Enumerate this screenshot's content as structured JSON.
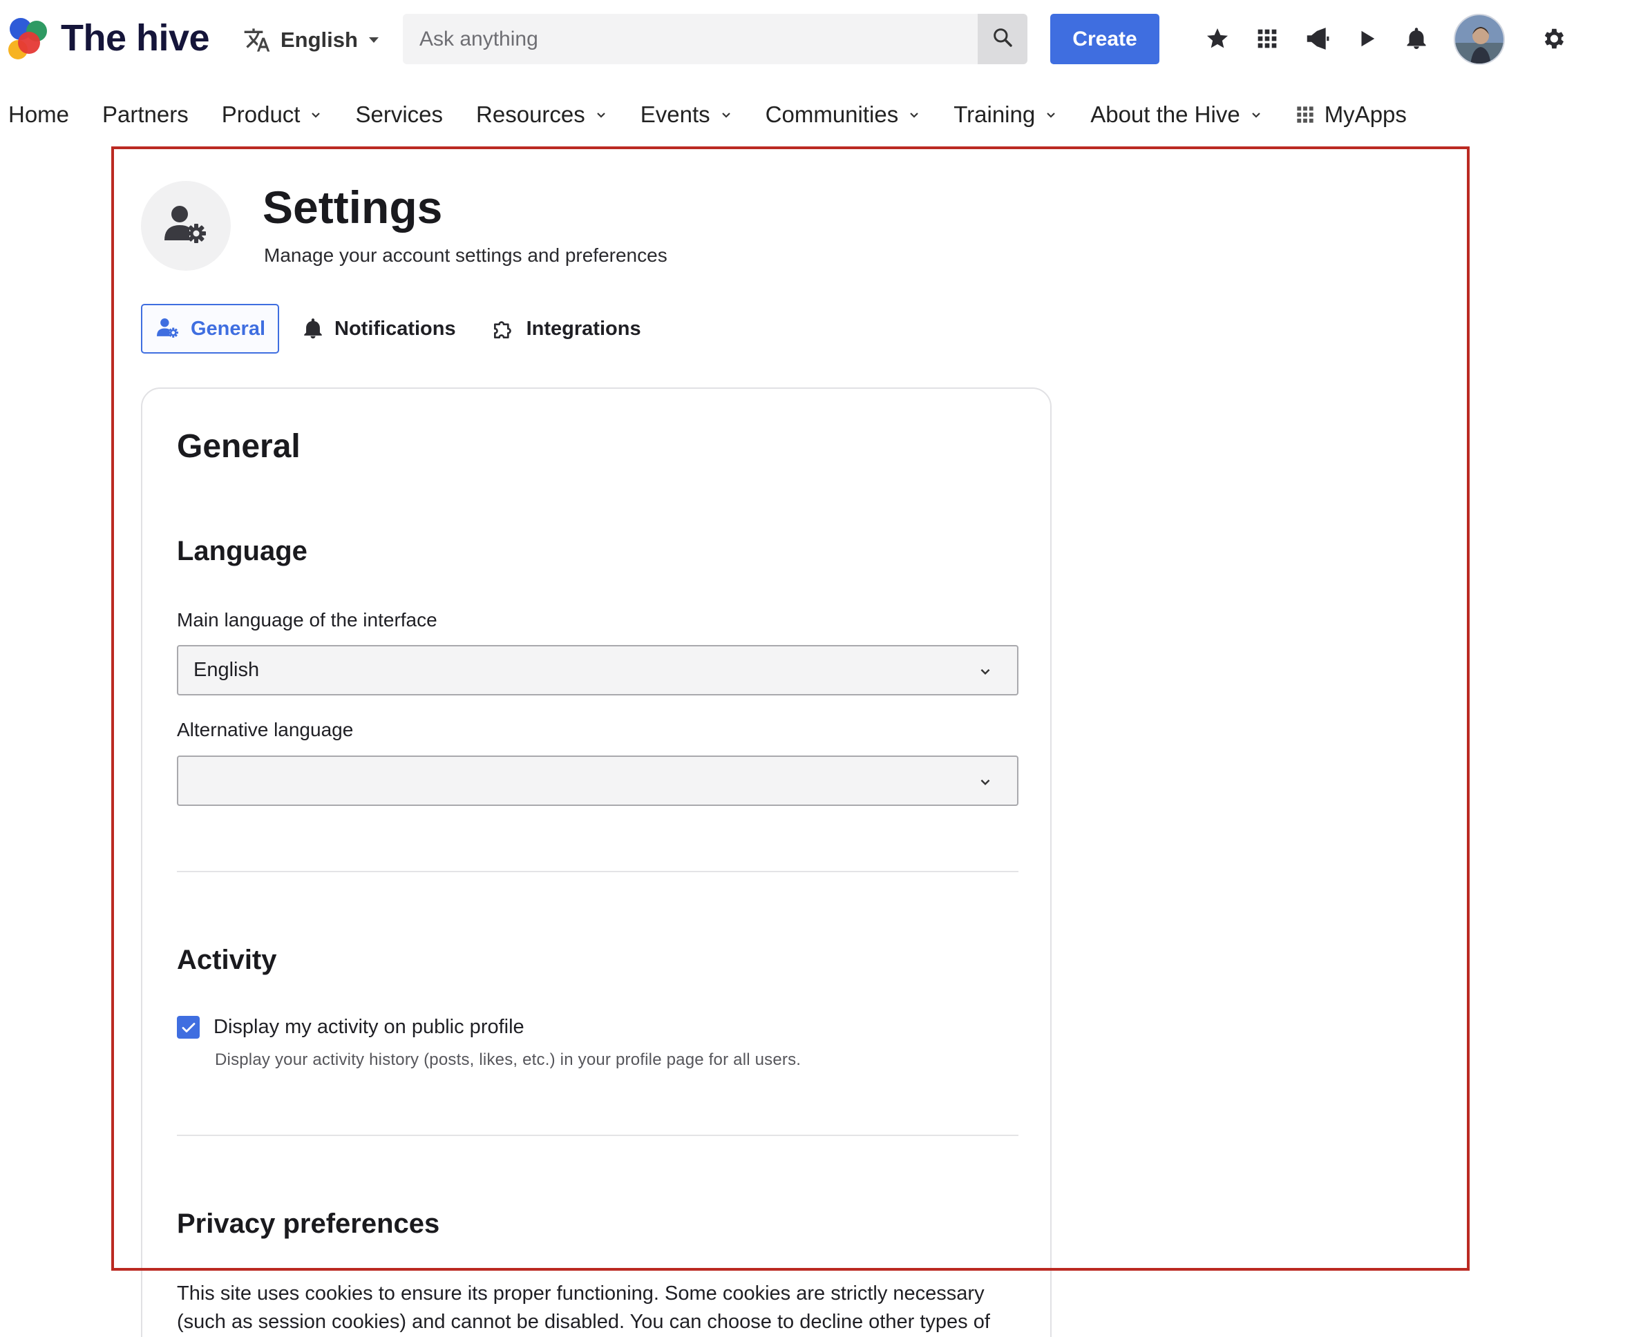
{
  "header": {
    "logo_text": "The hive",
    "language_label": "English",
    "search_placeholder": "Ask anything",
    "create_label": "Create",
    "icons": [
      "star-icon",
      "apps-grid-icon",
      "megaphone-icon",
      "play-icon",
      "bell-icon",
      "avatar",
      "gear-icon"
    ]
  },
  "nav": {
    "items": [
      {
        "label": "Home",
        "dropdown": false
      },
      {
        "label": "Partners",
        "dropdown": false
      },
      {
        "label": "Product",
        "dropdown": true
      },
      {
        "label": "Services",
        "dropdown": false
      },
      {
        "label": "Resources",
        "dropdown": true
      },
      {
        "label": "Events",
        "dropdown": true
      },
      {
        "label": "Communities",
        "dropdown": true
      },
      {
        "label": "Training",
        "dropdown": true
      },
      {
        "label": "About the Hive",
        "dropdown": true
      }
    ],
    "myapps_label": "MyApps"
  },
  "settings": {
    "title": "Settings",
    "subtitle": "Manage your account settings and preferences",
    "tabs": [
      {
        "label": "General",
        "icon": "user-gear-icon",
        "active": true
      },
      {
        "label": "Notifications",
        "icon": "bell-icon",
        "active": false
      },
      {
        "label": "Integrations",
        "icon": "puzzle-icon",
        "active": false
      }
    ]
  },
  "general": {
    "heading": "General",
    "language": {
      "heading": "Language",
      "main_label": "Main language of the interface",
      "main_value": "English",
      "alt_label": "Alternative language",
      "alt_value": ""
    },
    "activity": {
      "heading": "Activity",
      "checkbox_label": "Display my activity on public profile",
      "checkbox_checked": true,
      "checkbox_description": "Display your activity history (posts, likes, etc.) in your profile page for all users."
    },
    "privacy": {
      "heading": "Privacy preferences",
      "text_line1": "This site uses cookies to ensure its proper functioning. Some cookies are strictly necessary",
      "text_line2": "(such as session cookies) and cannot be disabled. You can choose to decline other types of"
    }
  },
  "colors": {
    "accent": "#3f6ee0",
    "frame": "#bb2a22"
  }
}
